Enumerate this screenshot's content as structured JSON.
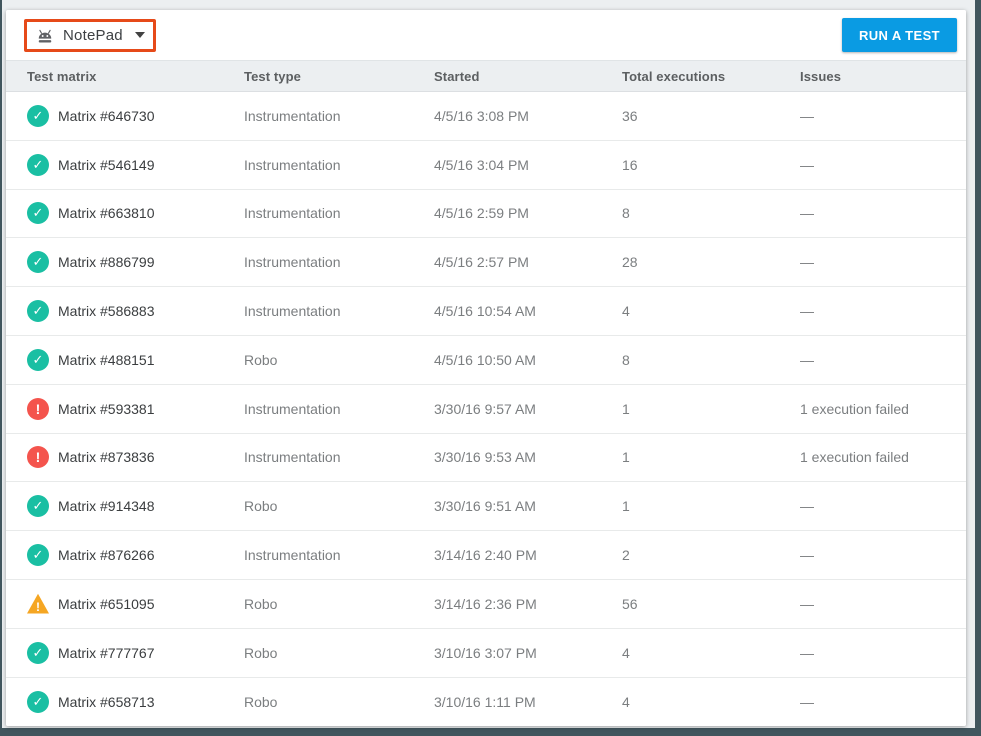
{
  "toolbar": {
    "app_selector": {
      "label": "NotePad"
    },
    "run_test_label": "RUN A TEST"
  },
  "icons": {
    "success": {
      "name": "check-circle-icon",
      "glyph": "✓"
    },
    "error": {
      "name": "error-circle-icon",
      "glyph": "!"
    },
    "warning": {
      "name": "warning-triangle-icon",
      "glyph": "!"
    },
    "app": "android-icon",
    "caret": "caret-down-icon"
  },
  "colors": {
    "accent_blue": "#0a9be3",
    "success_teal": "#1abfa3",
    "error_red": "#f4544d",
    "warning_amber": "#f5a623",
    "annotation_orange": "#e64a19",
    "frame_slate": "#41565e"
  },
  "table": {
    "columns": [
      "Test matrix",
      "Test type",
      "Started",
      "Total executions",
      "Issues"
    ],
    "rows": [
      {
        "status": "success",
        "matrix": "Matrix #646730",
        "type": "Instrumentation",
        "started": "4/5/16 3:08 PM",
        "total": "36",
        "issues": "—"
      },
      {
        "status": "success",
        "matrix": "Matrix #546149",
        "type": "Instrumentation",
        "started": "4/5/16 3:04 PM",
        "total": "16",
        "issues": "—"
      },
      {
        "status": "success",
        "matrix": "Matrix #663810",
        "type": "Instrumentation",
        "started": "4/5/16 2:59 PM",
        "total": "8",
        "issues": "—"
      },
      {
        "status": "success",
        "matrix": "Matrix #886799",
        "type": "Instrumentation",
        "started": "4/5/16 2:57 PM",
        "total": "28",
        "issues": "—"
      },
      {
        "status": "success",
        "matrix": "Matrix #586883",
        "type": "Instrumentation",
        "started": "4/5/16 10:54 AM",
        "total": "4",
        "issues": "—"
      },
      {
        "status": "success",
        "matrix": "Matrix #488151",
        "type": "Robo",
        "started": "4/5/16 10:50 AM",
        "total": "8",
        "issues": "—"
      },
      {
        "status": "error",
        "matrix": "Matrix #593381",
        "type": "Instrumentation",
        "started": "3/30/16 9:57 AM",
        "total": "1",
        "issues": "1 execution failed"
      },
      {
        "status": "error",
        "matrix": "Matrix #873836",
        "type": "Instrumentation",
        "started": "3/30/16 9:53 AM",
        "total": "1",
        "issues": "1 execution failed"
      },
      {
        "status": "success",
        "matrix": "Matrix #914348",
        "type": "Robo",
        "started": "3/30/16 9:51 AM",
        "total": "1",
        "issues": "—"
      },
      {
        "status": "success",
        "matrix": "Matrix #876266",
        "type": "Instrumentation",
        "started": "3/14/16 2:40 PM",
        "total": "2",
        "issues": "—"
      },
      {
        "status": "warning",
        "matrix": "Matrix #651095",
        "type": "Robo",
        "started": "3/14/16 2:36 PM",
        "total": "56",
        "issues": "—"
      },
      {
        "status": "success",
        "matrix": "Matrix #777767",
        "type": "Robo",
        "started": "3/10/16 3:07 PM",
        "total": "4",
        "issues": "—"
      },
      {
        "status": "success",
        "matrix": "Matrix #658713",
        "type": "Robo",
        "started": "3/10/16 1:11 PM",
        "total": "4",
        "issues": "—"
      }
    ]
  }
}
